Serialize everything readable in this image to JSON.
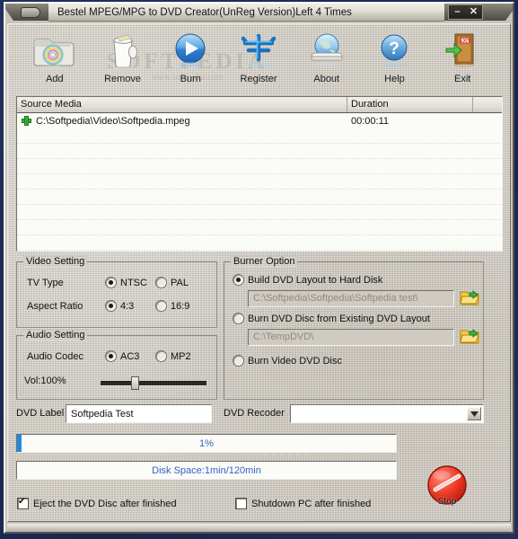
{
  "window": {
    "title": "Bestel MPEG/MPG to DVD Creator(UnReg Version)Left 4 Times",
    "minimize_label": "–",
    "close_label": "✕",
    "system_icon": "app-system-icon"
  },
  "watermark": {
    "text": "SOFTPEDIA",
    "sub": "www.softpedia.com"
  },
  "toolbar": {
    "items": [
      {
        "label": "Add",
        "icon": "add-folder-disc-icon"
      },
      {
        "label": "Remove",
        "icon": "trash-bin-icon"
      },
      {
        "label": "Burn",
        "icon": "play-burn-icon"
      },
      {
        "label": "Register",
        "icon": "key-register-icon"
      },
      {
        "label": "About",
        "icon": "globe-about-icon"
      },
      {
        "label": "Help",
        "icon": "question-help-icon"
      },
      {
        "label": "Exit",
        "icon": "exit-door-icon"
      }
    ]
  },
  "media_list": {
    "columns": [
      "Source Media",
      "Duration",
      ""
    ],
    "rows": [
      {
        "source": "C:\\Softpedia\\Video\\Softpedia.mpeg",
        "duration": "00:00:11",
        "icon": "green-plus-icon"
      }
    ]
  },
  "video_setting": {
    "title": "Video Setting",
    "tv_type_label": "TV Type",
    "tv_type_options": [
      "NTSC",
      "PAL"
    ],
    "tv_type_selected": "NTSC",
    "aspect_label": "Aspect Ratio",
    "aspect_options": [
      "4:3",
      "16:9"
    ],
    "aspect_selected": "4:3"
  },
  "audio_setting": {
    "title": "Audio Setting",
    "codec_label": "Audio Codec",
    "codec_options": [
      "AC3",
      "MP2"
    ],
    "codec_selected": "AC3",
    "volume_label": "Vol:100%",
    "volume_percent": 100
  },
  "burner_option": {
    "title": "Burner Option",
    "options": [
      {
        "label": "Build DVD Layout to Hard Disk",
        "selected": true
      },
      {
        "label": "Burn DVD Disc from Existing DVD Layout",
        "selected": false
      },
      {
        "label": "Burn Video DVD Disc",
        "selected": false
      }
    ],
    "path1": "C:\\Softpedia\\Softpedia\\Softpedia test\\",
    "path2": "C:\\TempDVD\\",
    "browse_icon": "open-folder-icon"
  },
  "dvd_label": {
    "label": "DVD Label",
    "value": "Softpedia Test"
  },
  "dvd_recoder": {
    "label": "DVD Recoder",
    "value": "",
    "arrow_icon": "chevron-down-icon"
  },
  "progress": {
    "percent_text": "1%",
    "percent_value": 1,
    "disk_space_text": "Disk Space:1min/120min"
  },
  "stop_button": {
    "label": "Stop",
    "icon": "stop-sign-icon"
  },
  "footer": {
    "eject": {
      "label": "Eject the DVD Disc after finished",
      "checked": true
    },
    "shutdown": {
      "label": "Shutdown PC after finished",
      "checked": false
    }
  },
  "colors": {
    "desktop": "#1e2a5a",
    "face": "#d3cfc6",
    "accent_blue": "#1f8ae0",
    "text_blue": "#3563c4",
    "stop_red": "#e8392a"
  }
}
